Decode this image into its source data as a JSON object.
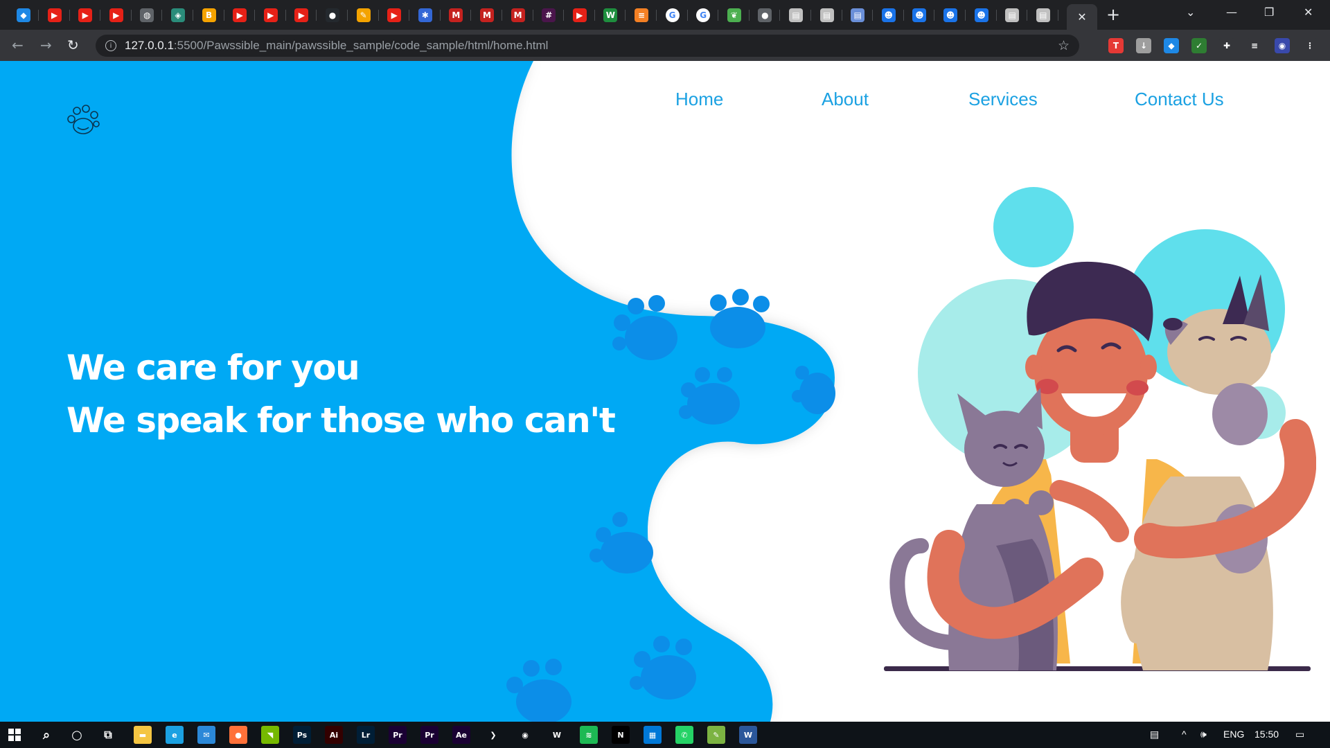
{
  "browser": {
    "tabs": [
      {
        "icon": "gem-icon",
        "color": "#1e88e5",
        "glyph": "◆"
      },
      {
        "icon": "youtube-icon",
        "color": "#e62117",
        "glyph": "▶"
      },
      {
        "icon": "youtube-icon",
        "color": "#e62117",
        "glyph": "▶"
      },
      {
        "icon": "youtube-icon",
        "color": "#e62117",
        "glyph": "▶"
      },
      {
        "icon": "globe-icon",
        "color": "#5f6368",
        "glyph": "◍"
      },
      {
        "icon": "ethereum-icon",
        "color": "#2a8c7a",
        "glyph": "◈"
      },
      {
        "icon": "b-logo-icon",
        "color": "#f5a300",
        "glyph": "B"
      },
      {
        "icon": "youtube-icon",
        "color": "#e62117",
        "glyph": "▶"
      },
      {
        "icon": "youtube-icon",
        "color": "#e62117",
        "glyph": "▶"
      },
      {
        "icon": "youtube-icon",
        "color": "#e62117",
        "glyph": "▶"
      },
      {
        "icon": "github-icon",
        "color": "#24292e",
        "glyph": "●"
      },
      {
        "icon": "notes-icon",
        "color": "#f4a300",
        "glyph": "✎"
      },
      {
        "icon": "youtube-icon",
        "color": "#e62117",
        "glyph": "▶"
      },
      {
        "icon": "puzzle-app-icon",
        "color": "#3367d6",
        "glyph": "✱"
      },
      {
        "icon": "gmail-icon",
        "color": "#c5221f",
        "glyph": "M"
      },
      {
        "icon": "gmail-icon",
        "color": "#c5221f",
        "glyph": "M"
      },
      {
        "icon": "gmail-icon",
        "color": "#c5221f",
        "glyph": "M"
      },
      {
        "icon": "slack-icon",
        "color": "#4a154b",
        "glyph": "#"
      },
      {
        "icon": "youtube-icon",
        "color": "#e62117",
        "glyph": "▶"
      },
      {
        "icon": "w-logo-icon",
        "color": "#1e8e3e",
        "glyph": "W"
      },
      {
        "icon": "stackoverflow-icon",
        "color": "#f48024",
        "glyph": "≡"
      },
      {
        "icon": "google-icon",
        "color": "#ffffff",
        "glyph": "G"
      },
      {
        "icon": "google-icon",
        "color": "#ffffff",
        "glyph": "G"
      },
      {
        "icon": "leaf-icon",
        "color": "#4caf50",
        "glyph": "❦"
      },
      {
        "icon": "apple-icon",
        "color": "#5f6368",
        "glyph": "●"
      },
      {
        "icon": "page-icon",
        "color": "#c0c0c0",
        "glyph": "▤"
      },
      {
        "icon": "page-icon",
        "color": "#c0c0c0",
        "glyph": "▤"
      },
      {
        "icon": "page-icon",
        "color": "#6a8fd8",
        "glyph": "▤"
      },
      {
        "icon": "robot-icon",
        "color": "#1a73e8",
        "glyph": "☻"
      },
      {
        "icon": "robot-icon",
        "color": "#1a73e8",
        "glyph": "☻"
      },
      {
        "icon": "robot-icon",
        "color": "#1a73e8",
        "glyph": "☻"
      },
      {
        "icon": "robot-icon",
        "color": "#1a73e8",
        "glyph": "☻"
      },
      {
        "icon": "page-icon",
        "color": "#c0c0c0",
        "glyph": "▤"
      },
      {
        "icon": "page-icon",
        "color": "#c0c0c0",
        "glyph": "▤"
      }
    ],
    "url_host": "127.0.0.1",
    "url_path": ":5500/Pawssible_main/pawssible_sample/code_sample/html/home.html",
    "extensions": [
      {
        "icon": "tp-extension-icon",
        "color": "#e53935",
        "glyph": "T"
      },
      {
        "icon": "download-extension-icon",
        "color": "#9e9e9e",
        "glyph": "↓"
      },
      {
        "icon": "gem-extension-icon",
        "color": "#1e88e5",
        "glyph": "◆"
      },
      {
        "icon": "shield-extension-icon",
        "color": "#2e7d32",
        "glyph": "✓"
      },
      {
        "icon": "puzzle-extension-icon",
        "color": "#35363a",
        "glyph": "✚"
      },
      {
        "icon": "playlist-icon",
        "color": "#35363a",
        "glyph": "≡"
      },
      {
        "icon": "profile-avatar-icon",
        "color": "#3949ab",
        "glyph": "◉"
      },
      {
        "icon": "kebab-menu-icon",
        "color": "#35363a",
        "glyph": "⋮"
      }
    ]
  },
  "site": {
    "nav": [
      "Home",
      "About",
      "Services",
      "Contact Us"
    ],
    "hero_line_1": "We care for you",
    "hero_line_2": "We speak for those who can't",
    "colors": {
      "brand_blue": "#03a9f4",
      "nav_text": "#1ba1e2",
      "paw": "#0c8ee8",
      "hero_text": "#ffffff"
    }
  },
  "taskbar": {
    "apps": [
      {
        "icon": "file-explorer-icon",
        "color": "#f4c542",
        "glyph": "▬"
      },
      {
        "icon": "edge-icon",
        "color": "#1ba1e2",
        "glyph": "e"
      },
      {
        "icon": "mail-icon",
        "color": "#2b88d8",
        "glyph": "✉"
      },
      {
        "icon": "firefox-icon",
        "color": "#ff7139",
        "glyph": "●"
      },
      {
        "icon": "nvidia-icon",
        "color": "#76b900",
        "glyph": "◥"
      },
      {
        "icon": "photoshop-icon",
        "color": "#001e36",
        "glyph": "Ps"
      },
      {
        "icon": "illustrator-icon",
        "color": "#330000",
        "glyph": "Ai"
      },
      {
        "icon": "lightroom-icon",
        "color": "#001e36",
        "glyph": "Lr"
      },
      {
        "icon": "premiere-icon",
        "color": "#1a0033",
        "glyph": "Pr"
      },
      {
        "icon": "premiere-icon",
        "color": "#1a0033",
        "glyph": "Pr"
      },
      {
        "icon": "after-effects-icon",
        "color": "#1a0033",
        "glyph": "Ae"
      },
      {
        "icon": "vscode-icon",
        "color": "#0e1318",
        "glyph": "❯"
      },
      {
        "icon": "chrome-icon",
        "color": "#0e1318",
        "glyph": "◉"
      },
      {
        "icon": "wordpress-icon",
        "color": "#0e1318",
        "glyph": "W"
      },
      {
        "icon": "spotify-icon",
        "color": "#1db954",
        "glyph": "≋"
      },
      {
        "icon": "netflix-icon",
        "color": "#000000",
        "glyph": "N"
      },
      {
        "icon": "calculator-icon",
        "color": "#0078d7",
        "glyph": "▦"
      },
      {
        "icon": "whatsapp-icon",
        "color": "#25d366",
        "glyph": "✆"
      },
      {
        "icon": "notepad-icon",
        "color": "#7cb342",
        "glyph": "✎"
      },
      {
        "icon": "word-icon",
        "color": "#2b579a",
        "glyph": "W"
      }
    ],
    "language": "ENG",
    "time": "15:50"
  }
}
